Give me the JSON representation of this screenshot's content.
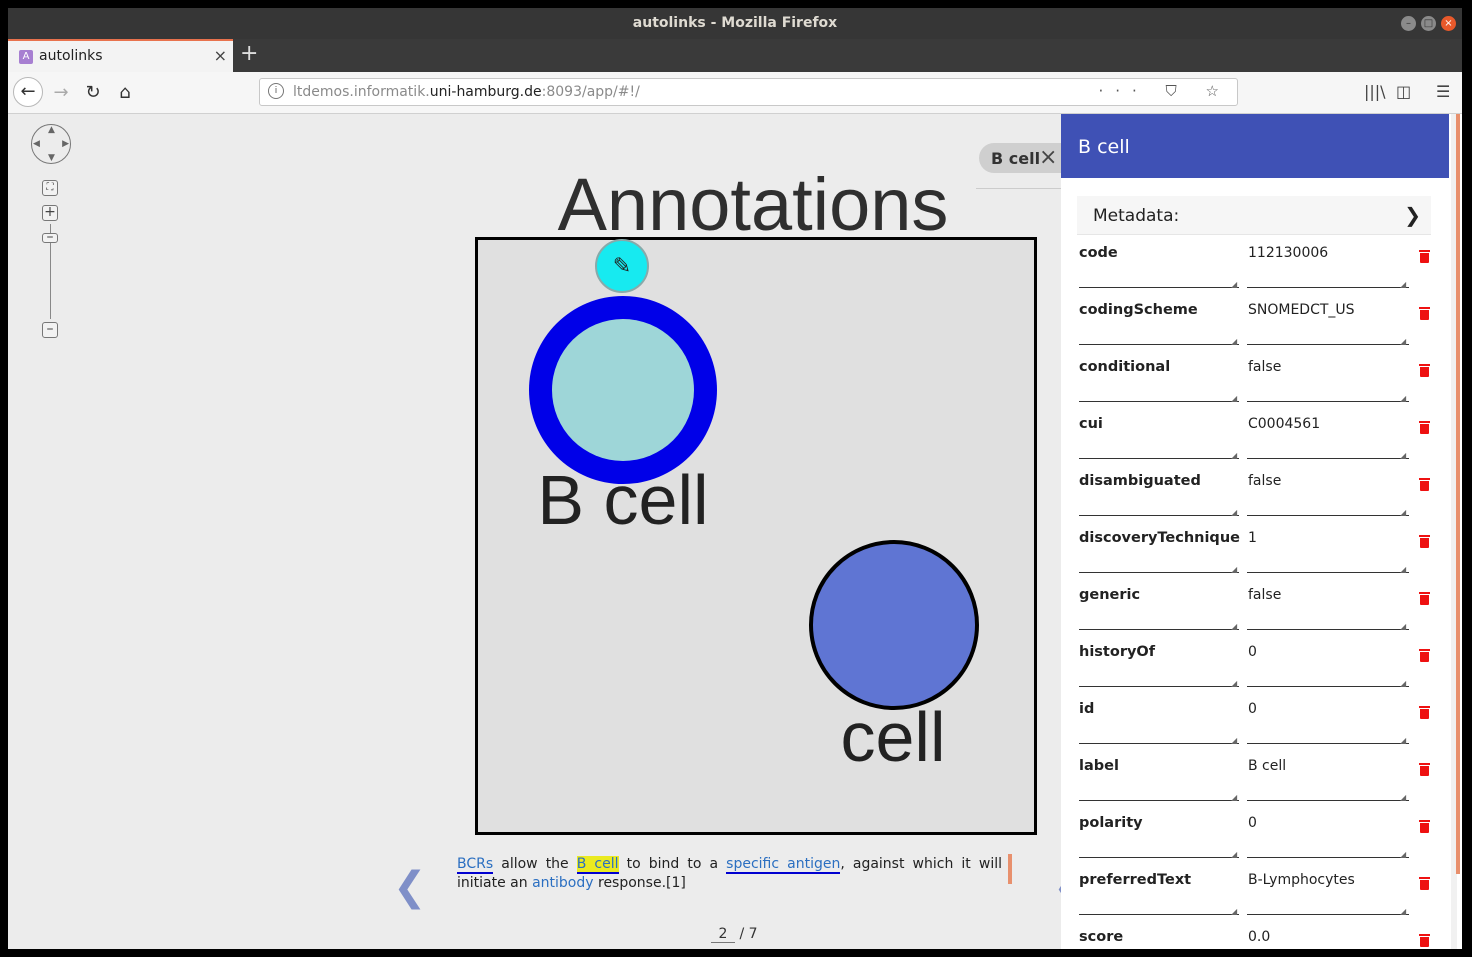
{
  "window": {
    "title": "autolinks - Mozilla Firefox"
  },
  "tab": {
    "title": "autolinks",
    "favicon": "autolinks-favicon",
    "close": "×",
    "new_tab": "+"
  },
  "nav": {
    "url_host_prefix": "ltdemos.informatik.",
    "url_domain": "uni-hamburg.de",
    "url_path": ":8093/app/#!/",
    "url_icons": "··· ⛉ ☆"
  },
  "graph": {
    "heading": "Annotations",
    "selected_tag": "B cell",
    "nodes": [
      {
        "label": "B cell",
        "selected": true,
        "fill": "#9ed6d8",
        "ring": "#0000e8"
      },
      {
        "label": "cell",
        "selected": false,
        "fill": "#5f75d3",
        "ring": "#000000"
      }
    ],
    "edit_color": "#17eaf0"
  },
  "sentence": {
    "w1": "BCRs",
    "t1": " allow the ",
    "w2": "B cell",
    "t2": " to bind to a ",
    "w3": "specific antigen",
    "t3": ", against which it will initiate an ",
    "w4": "antibody",
    "t4": " response.[1]"
  },
  "pager": {
    "current": "2",
    "total": "/ 7"
  },
  "panel": {
    "title": "B cell",
    "accent": "#3f51b5",
    "metadata_label": "Metadata:",
    "fields": [
      {
        "key": "code",
        "value": "112130006"
      },
      {
        "key": "codingScheme",
        "value": "SNOMEDCT_US"
      },
      {
        "key": "conditional",
        "value": "false"
      },
      {
        "key": "cui",
        "value": "C0004561"
      },
      {
        "key": "disambiguated",
        "value": "false"
      },
      {
        "key": "discoveryTechnique",
        "value": "1"
      },
      {
        "key": "generic",
        "value": "false"
      },
      {
        "key": "historyOf",
        "value": "0"
      },
      {
        "key": "id",
        "value": "0"
      },
      {
        "key": "label",
        "value": "B cell"
      },
      {
        "key": "polarity",
        "value": "0"
      },
      {
        "key": "preferredText",
        "value": "B-Lymphocytes"
      },
      {
        "key": "score",
        "value": "0.0"
      }
    ]
  }
}
